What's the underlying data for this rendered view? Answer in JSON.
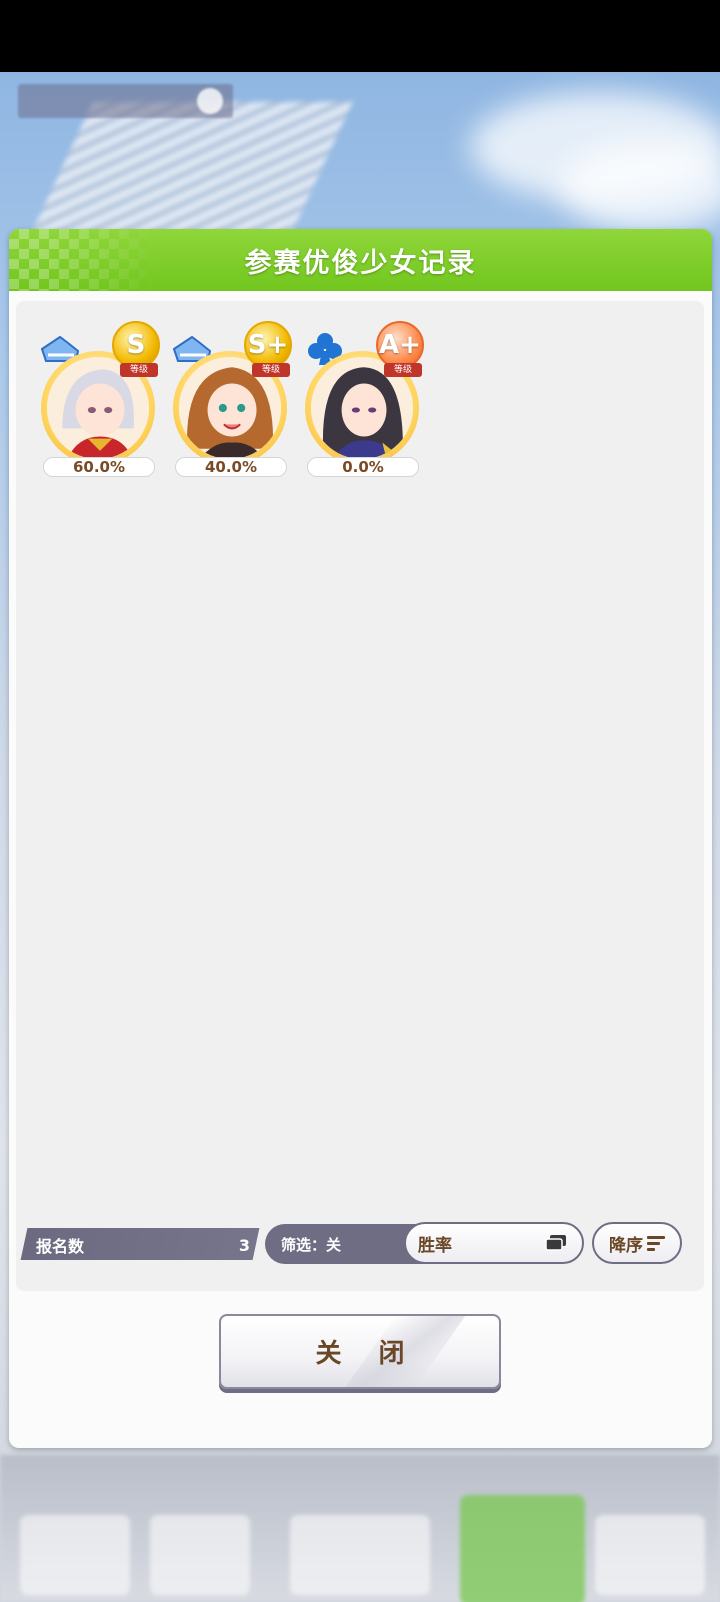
{
  "dialog": {
    "title": "参赛优俊少女记录",
    "close_label": "关 闭"
  },
  "entries": [
    {
      "rank": "S",
      "rank_caption": "等级",
      "win_rate": "60.0%",
      "type_icon": "shoe-icon"
    },
    {
      "rank": "S+",
      "rank_caption": "等级",
      "win_rate": "40.0%",
      "type_icon": "shoe-icon"
    },
    {
      "rank": "A+",
      "rank_caption": "等级",
      "win_rate": "0.0%",
      "type_icon": "club-icon"
    }
  ],
  "footer": {
    "count_label": "报名数",
    "count_value": "3",
    "filter_label": "筛选：关",
    "sort_label": "胜率",
    "order_label": "降序"
  },
  "colors": {
    "header_green": "#7ccb2a",
    "bar_slate": "#6f6d84",
    "text_brown": "#6a4726"
  }
}
